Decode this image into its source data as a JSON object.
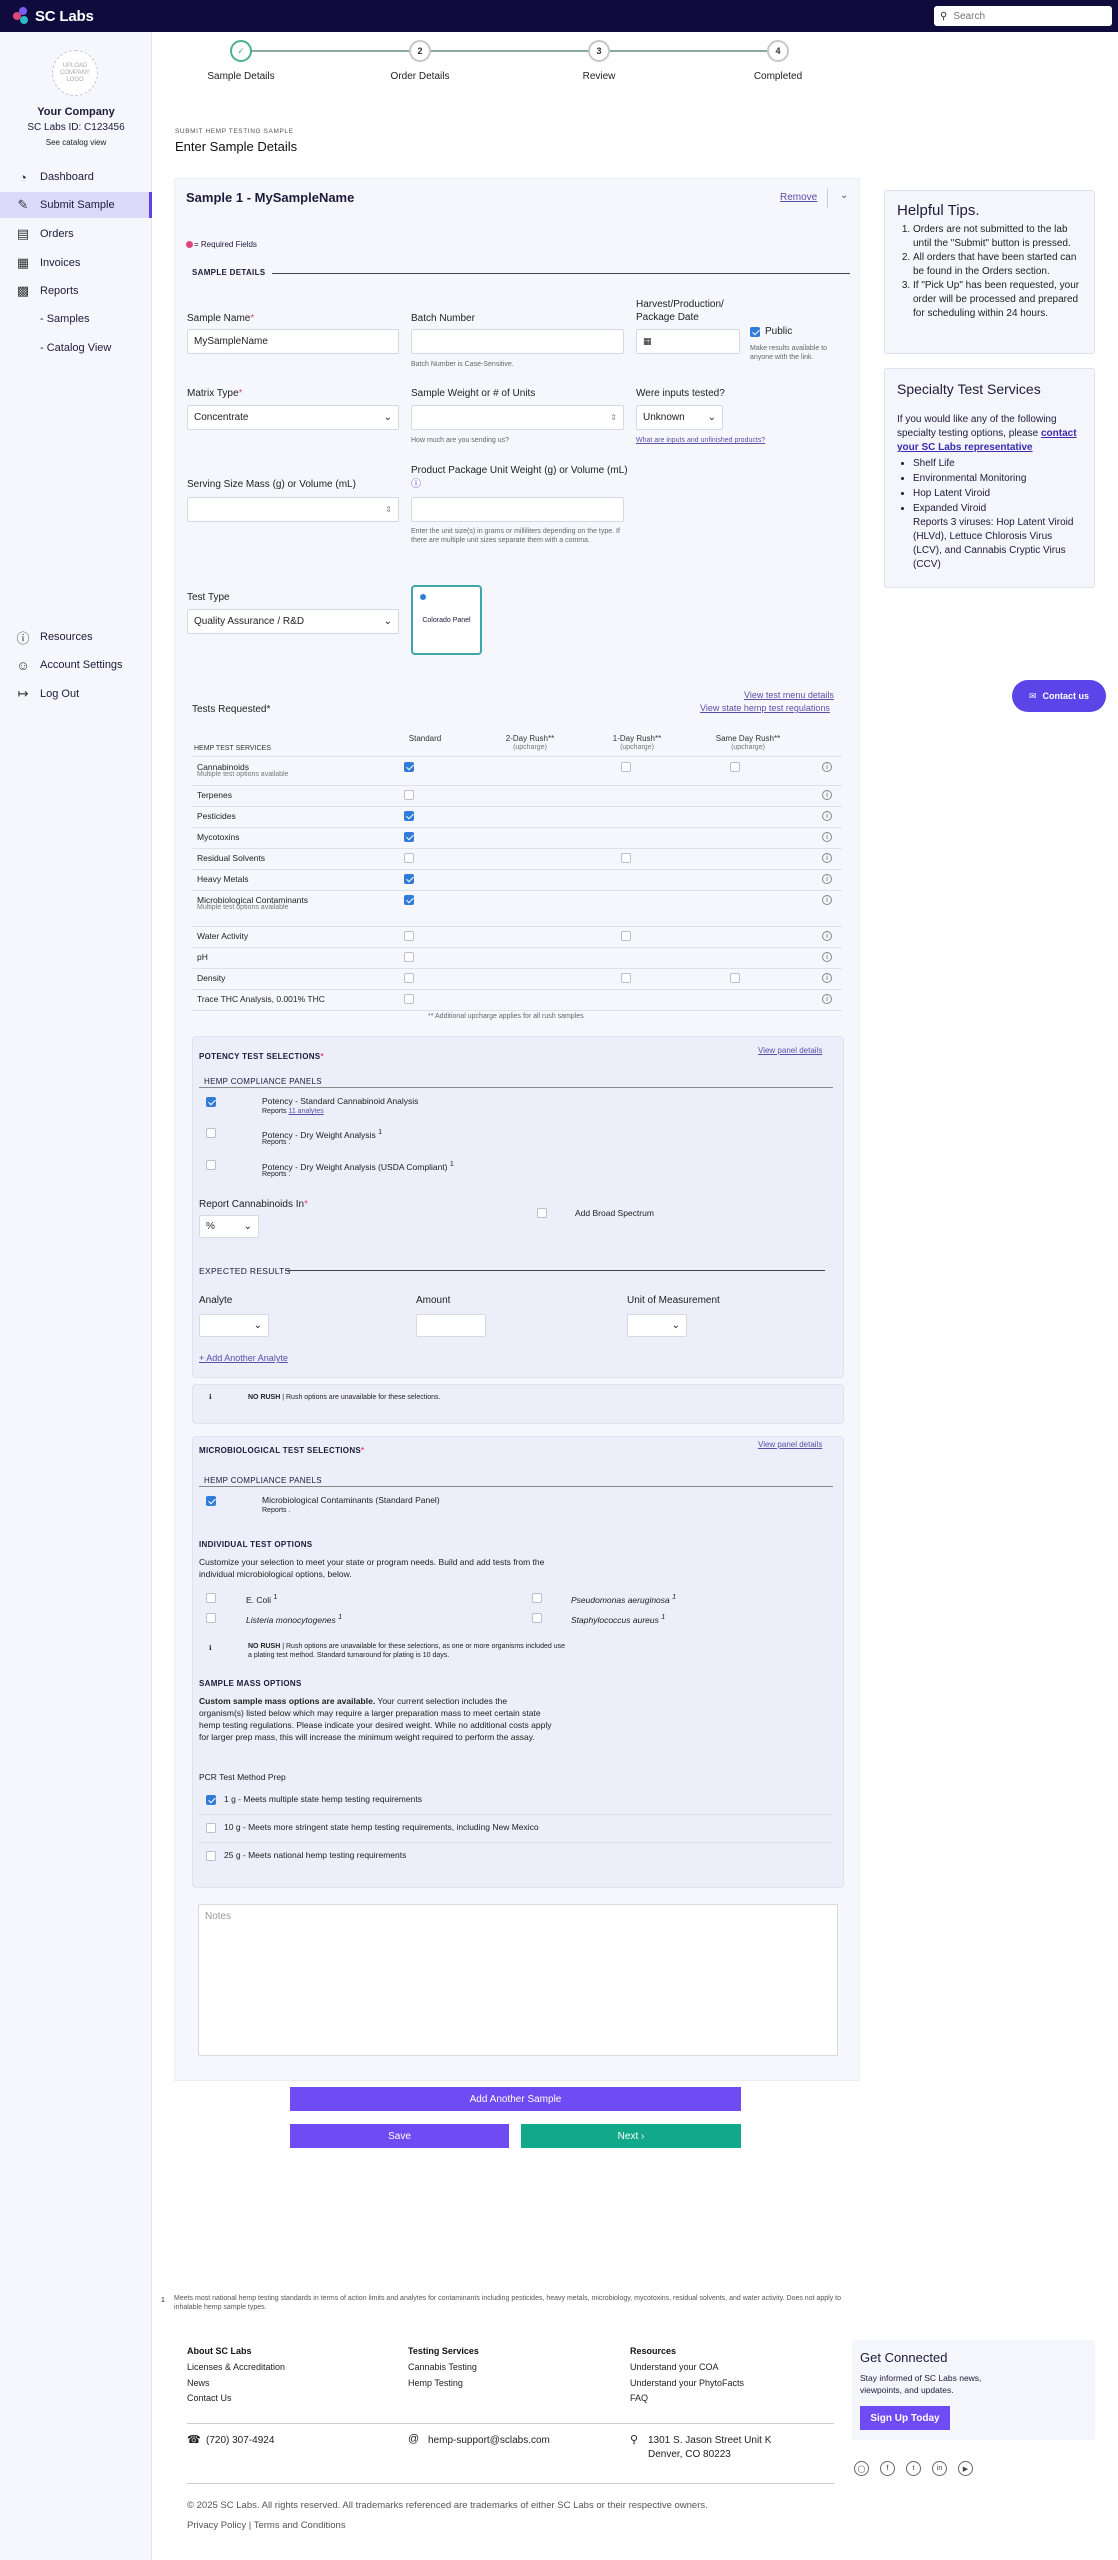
{
  "app": {
    "logo_text": "SC Labs",
    "search_placeholder": "Search"
  },
  "colors": {
    "brand_navy": "#0f0c3d",
    "accent_purple": "#5b45e8",
    "accent_teal": "#12a88a",
    "checkbox_blue": "#2f7dd8"
  },
  "sidebar": {
    "avatar_text": "UPLOAD COMPANY LOGO",
    "company": "Your Company",
    "labs_id": "SC Labs ID: C123456",
    "catalog_link": "See catalog view",
    "nav": [
      {
        "label": "Dashboard",
        "icon": "dashboard-icon"
      },
      {
        "label": "Submit Sample",
        "icon": "submit-icon"
      },
      {
        "label": "Orders",
        "icon": "orders-icon"
      },
      {
        "label": "Invoices",
        "icon": "invoices-icon"
      },
      {
        "label": "Reports",
        "icon": "reports-icon"
      },
      {
        "label": "- Samples"
      },
      {
        "label": "- Catalog View"
      },
      {
        "label": "Resources",
        "icon": "help-icon"
      },
      {
        "label": "Account Settings",
        "icon": "user-icon"
      },
      {
        "label": "Log Out",
        "icon": "logout-icon"
      }
    ]
  },
  "stepper": {
    "steps": [
      "Sample Details",
      "Order Details",
      "Review",
      "Completed"
    ],
    "numbers": [
      "2",
      "3",
      "4"
    ]
  },
  "page": {
    "breadcrumb": "SUBMIT HEMP TESTING SAMPLE",
    "title": "Enter Sample Details"
  },
  "sample": {
    "title": "Sample 1 - MySampleName",
    "remove": "Remove",
    "required_note": "= Required Fields",
    "section_details": "SAMPLE DETAILS",
    "fields": {
      "sample_name_label": "Sample Name",
      "sample_name_value": "MySampleName",
      "batch_label": "Batch Number",
      "batch_hint": "Batch Number is Case-Sensitive.",
      "harvest_label": "Harvest/Production/ Package Date",
      "public_label": "Public",
      "public_hint": "Make results available to anyone with the link.",
      "matrix_label": "Matrix Type",
      "matrix_value": "Concentrate",
      "weight_label": "Sample Weight or # of Units",
      "weight_hint": "How much are you sending us?",
      "inputs_label": "Were inputs tested?",
      "inputs_value": "Unknown",
      "inputs_link": "What are inputs and unfinished products?",
      "serving_label": "Serving Size Mass (g) or Volume (mL)",
      "package_label": "Product Package Unit Weight (g) or Volume (mL)",
      "package_hint": "Enter the unit size(s) in grams or milliliters depending on the type. If there are multiple unit sizes separate them with a comma.",
      "test_type_label": "Test Type",
      "test_type_value": "Quality Assurance / R&D",
      "panel_label": "Colorado Panel"
    },
    "tests": {
      "link_menu": "View test menu details",
      "link_regs": "View state hemp test regulations",
      "requested_label": "Tests Requested*",
      "col_service": "HEMP TEST SERVICES",
      "col_standard": "Standard",
      "col_2day": "2-Day Rush**",
      "col_1day": "1-Day Rush**",
      "col_same": "Same Day Rush**",
      "upcharge": "(upcharge)",
      "footnote": "** Additional upcharge applies for all rush samples",
      "rows": [
        {
          "name": "Cannabinoids",
          "sub": "Multiple test options available",
          "std": true
        },
        {
          "name": "Terpenes",
          "sub": "",
          "std": false
        },
        {
          "name": "Pesticides",
          "sub": "",
          "std": true
        },
        {
          "name": "Mycotoxins",
          "sub": "",
          "std": true
        },
        {
          "name": "Residual Solvents",
          "sub": "",
          "std": false
        },
        {
          "name": "Heavy Metals",
          "sub": "",
          "std": true
        },
        {
          "name": "Microbiological Contaminants",
          "sub": "Multiple test options available",
          "std": true
        },
        {
          "name": "Water Activity",
          "sub": "",
          "std": false
        },
        {
          "name": "pH",
          "sub": "",
          "std": false
        },
        {
          "name": "Density",
          "sub": "",
          "std": false
        },
        {
          "name": "Trace THC Analysis, 0.001% THC",
          "sub": "",
          "std": false
        }
      ]
    },
    "potency": {
      "title": "POTENCY TEST SELECTIONS",
      "view_details": "View panel details",
      "compliance": "HEMP COMPLIANCE PANELS",
      "opt1": "Potency - Standard Cannabinoid Analysis",
      "opt1_sub_pre": "Reports",
      "opt1_sub_link": "11 analytes",
      "opt2": "Potency - Dry Weight Analysis",
      "opt2_sub": "Reports .",
      "opt3": "Potency - Dry Weight Analysis (USDA Compliant)",
      "opt3_sub": "Reports .",
      "report_in_label": "Report Cannabinoids In",
      "report_in_value": "%",
      "broad_spectrum": "Add Broad Spectrum",
      "expected_results": "EXPECTED RESULTS",
      "analyte": "Analyte",
      "amount": "Amount",
      "uom": "Unit of Measurement",
      "add_analyte": "+ Add Another Analyte",
      "no_rush_bold": "NO RUSH",
      "no_rush_text": "| Rush options are unavailable for these selections."
    },
    "micro": {
      "title": "MICROBIOLOGICAL TEST SELECTIONS",
      "view_details": "View panel details",
      "compliance": "HEMP COMPLIANCE PANELS",
      "panel": "Microbiological Contaminants (Standard Panel)",
      "panel_sub": "Reports .",
      "individual": "INDIVIDUAL TEST OPTIONS",
      "individual_text": "Customize your selection to meet your state or program needs. Build and add tests from the individual microbiological options, below.",
      "ecoli": "E. Coli",
      "pseudo": "Pseudomonas aeruginosa",
      "listeria": "Listeria monocytogenes",
      "staph": "Staphylococcus aureus",
      "no_rush_bold": "NO RUSH",
      "no_rush_text": "| Rush options are unavailable for these selections, as one or more organisms included use a plating test method. Standard turnaround for plating is 10 days.",
      "mass_title": "SAMPLE MASS OPTIONS",
      "mass_bold": "Custom sample mass options are available.",
      "mass_text": " Your current selection includes the organism(s) listed below which may require a larger preparation mass to meet certain state hemp testing regulations. Please indicate your desired weight. While no additional costs apply for larger prep mass, this will increase the minimum weight required to perform the assay.",
      "pcr": "PCR Test Method Prep",
      "mass1": "1 g - Meets multiple state hemp testing requirements",
      "mass2": "10 g - Meets more stringent state hemp testing requirements, including New Mexico",
      "mass3": "25 g - Meets national hemp testing requirements"
    },
    "notes_placeholder": "Notes"
  },
  "actions": {
    "add_sample": "Add Another Sample",
    "save": "Save",
    "next": "Next ›"
  },
  "tips": {
    "title": "Helpful Tips.",
    "items": [
      "Orders are not submitted to the lab until the \"Submit\" button is pressed.",
      "All orders that have been started can be found in the Orders section.",
      "If \"Pick Up\" has been requested, your order will be processed and prepared for scheduling within 24 hours."
    ]
  },
  "specialty": {
    "title": "Specialty Test Services",
    "intro": "If you would like any of the following specialty testing options, please",
    "link": "contact your SC Labs representative",
    "items": [
      "Shelf Life",
      "Environmental Monitoring",
      "Hop Latent Viroid",
      "Expanded Viroid"
    ],
    "viroid_text": "Reports 3 viruses: Hop Latent Viroid (HLVd), Lettuce Chlorosis Virus (LCV), and Cannabis Cryptic Virus (CCV)"
  },
  "contact_button": "Contact us",
  "footnote_1": "Meets most national hemp testing standards in terms of action limits and analytes for contaminants including pesticides, heavy metals, microbiology, mycotoxins, residual solvents, and water activity. Does not apply to inhalable hemp sample types.",
  "footer": {
    "col1": {
      "title": "About SC Labs",
      "links": [
        "Licenses & Accreditation",
        "News",
        "Contact Us"
      ]
    },
    "col2": {
      "title": "Testing Services",
      "links": [
        "Cannabis Testing",
        "Hemp Testing"
      ]
    },
    "col3": {
      "title": "Resources",
      "links": [
        "Understand your COA",
        "Understand your PhytoFacts",
        "FAQ"
      ]
    },
    "newsletter": {
      "title": "Get Connected",
      "text": "Stay informed of SC Labs news, viewpoints, and updates.",
      "button": "Sign Up Today"
    },
    "phone": "(720) 307-4924",
    "email": "hemp-support@sclabs.com",
    "address1": "1301 S. Jason Street Unit K",
    "address2": "Denver, CO 80223",
    "copyright": "© 2025 SC Labs. All rights reserved. All trademarks referenced are trademarks of either SC Labs or their respective owners.",
    "privacy": "Privacy Policy",
    "sep": "|",
    "terms": "Terms and Conditions"
  }
}
